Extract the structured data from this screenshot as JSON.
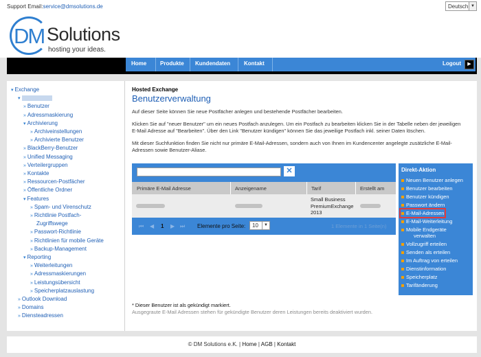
{
  "topbar": {
    "support_label": "Support Email:",
    "support_email": "service@dmsolutions.de",
    "language": "Deutsch"
  },
  "logo": {
    "dm": "DM",
    "solutions": "Solutions",
    "tagline": "hosting your ideas."
  },
  "nav": {
    "items": [
      "Home",
      "Produkte",
      "Kundendaten",
      "Kontakt"
    ],
    "logout": "Logout"
  },
  "sidebar": {
    "items": [
      {
        "label": "Exchange",
        "level": 0,
        "marker": "▾"
      },
      {
        "label": "",
        "level": 1,
        "marker": "▾",
        "redacted": true
      },
      {
        "label": "Benutzer",
        "level": 2,
        "marker": "»"
      },
      {
        "label": "Adressmaskierung",
        "level": 2,
        "marker": "»"
      },
      {
        "label": "Archivierung",
        "level": 2,
        "marker": "▾"
      },
      {
        "label": "Archiveinstellungen",
        "level": 3,
        "marker": "»"
      },
      {
        "label": "Archivierte Benutzer",
        "level": 3,
        "marker": "»"
      },
      {
        "label": "BlackBerry-Benutzer",
        "level": 2,
        "marker": "»"
      },
      {
        "label": "Unified Messaging",
        "level": 2,
        "marker": "»"
      },
      {
        "label": "Verteilergruppen",
        "level": 2,
        "marker": "»"
      },
      {
        "label": "Kontakte",
        "level": 2,
        "marker": "»"
      },
      {
        "label": "Ressourcen-Postfächer",
        "level": 2,
        "marker": "»"
      },
      {
        "label": "Öffentliche Ordner",
        "level": 2,
        "marker": "»"
      },
      {
        "label": "Features",
        "level": 2,
        "marker": "▾"
      },
      {
        "label": "Spam- und Virenschutz",
        "level": 3,
        "marker": "»"
      },
      {
        "label": "Richtlinie Postfach-",
        "level": 3,
        "marker": "»"
      },
      {
        "label": "Zugriffswege",
        "level": 3,
        "marker": ""
      },
      {
        "label": "Passwort-Richtlinie",
        "level": 3,
        "marker": "»"
      },
      {
        "label": "Richtlinien für mobile Geräte",
        "level": 3,
        "marker": "»"
      },
      {
        "label": "Backup-Management",
        "level": 3,
        "marker": "»"
      },
      {
        "label": "Reporting",
        "level": 2,
        "marker": "▾"
      },
      {
        "label": "Weiterleitungen",
        "level": 3,
        "marker": "»"
      },
      {
        "label": "Adressmaskierungen",
        "level": 3,
        "marker": "»"
      },
      {
        "label": "Leistungsübersicht",
        "level": 3,
        "marker": "»"
      },
      {
        "label": "Speicherplatzauslastung",
        "level": 3,
        "marker": "»"
      },
      {
        "label": "Outlook Download",
        "level": 1,
        "marker": "»"
      },
      {
        "label": "Domains",
        "level": 1,
        "marker": "»"
      },
      {
        "label": "Diensteadressen",
        "level": 1,
        "marker": "»"
      }
    ]
  },
  "content": {
    "subtitle": "Hosted Exchange",
    "title": "Benutzerverwaltung",
    "p1": "Auf dieser Seite können Sie neue Postfächer anlegen und bestehende Postfächer bearbeiten.",
    "p2a": "Klicken Sie auf \"neuer Benutzer\" um ein neues Postfach anzulegen. Um ein Postfach zu bearbeiten klicken Sie in der Tabelle neben der jeweiligen",
    "p2b": "E-Mail Adresse auf \"Bearbeiten\". Über den Link \"Benutzer kündigen\" können Sie das jeweilige Postfach inkl. seiner Daten löschen.",
    "p3a": "Mit dieser Suchfunktion finden Sie nicht nur primäre E-Mail-Adressen, sondern auch von Ihnen im Kundencenter angelegte zusätzliche E-Mail-",
    "p3b": "Adressen sowie Benutzer-Aliase."
  },
  "table": {
    "search_placeholder": "",
    "columns": [
      "Primäre E-Mail Adresse",
      "Anzeigename",
      "Tarif",
      "Erstellt am"
    ],
    "rows": [
      {
        "tarif_lines": [
          "Small Business",
          "PremiumExchange",
          "2013"
        ]
      }
    ],
    "pager": {
      "first": "⏮",
      "prev": "◀",
      "page": "1",
      "next": "▶",
      "last": "⏭",
      "per_page_label": "Elemente pro Seite:",
      "per_page_value": "10",
      "info": "1 Elemente in 1 Seite(n)"
    }
  },
  "direkt": {
    "title": "Direkt-Aktion",
    "items": [
      "Neuen Benutzer anlegen",
      "Benutzer bearbeiten",
      "Benutzer kündigen",
      "Passwort ändern",
      "E-Mail-Adressen",
      "E-Mail-Weiterleitung",
      "Mobile Endgeräte",
      "verwalten",
      "Vollzugriff erteilen",
      "Senden als erteilen",
      "Im Auftrag von erteilen",
      "Dienstinformation",
      "Speicherplatz",
      "Tarifänderung"
    ],
    "highlighted_index": 4,
    "bullet_color": "#f4a000"
  },
  "notes": {
    "n1": "* Dieser Benutzer ist als gekündigt markiert.",
    "n2": "Ausgegraute E-Mail Adressen stehen für gekündigte Benutzer deren Leistungen bereits deaktiviert wurden."
  },
  "footer": {
    "copyright": "© DM Solutions e.K.",
    "links": [
      "Home",
      "AGB",
      "Kontakt"
    ]
  },
  "colors": {
    "accent": "#3b86d6",
    "link": "#1f5fb5",
    "highlight": "#e23b3b"
  }
}
